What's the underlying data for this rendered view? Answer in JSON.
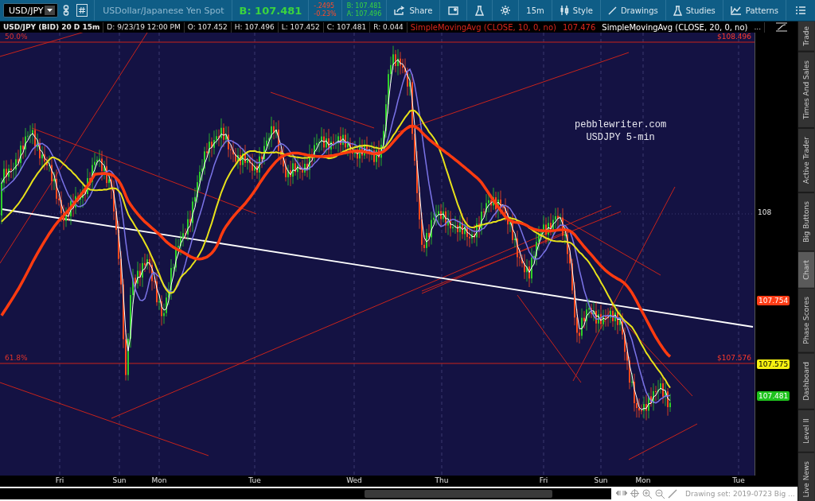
{
  "toolbar": {
    "symbol": "USD/JPY",
    "description": "USDollar/Japanese Yen Spot",
    "last": "B: 107.481",
    "change": "-.2495",
    "change_pct": "-0.23%",
    "bid": "B: 107.481",
    "ask": "A: 107.496",
    "buttons": [
      {
        "kind": "labeled",
        "label": "Share"
      },
      {
        "kind": "icon"
      },
      {
        "kind": "icon"
      },
      {
        "kind": "icon"
      },
      {
        "kind": "labeled",
        "label": "15m"
      },
      {
        "kind": "labeled",
        "label": "Style"
      },
      {
        "kind": "labeled",
        "label": "Drawings"
      },
      {
        "kind": "labeled",
        "label": "Studies"
      },
      {
        "kind": "labeled",
        "label": "Patterns"
      },
      {
        "kind": "icon"
      }
    ]
  },
  "header": {
    "title": "USD/JPY (BID) 20 D 15m",
    "fields": [
      "D: 9/23/19 12:00 PM",
      "O: 107.452",
      "H: 107.496",
      "L: 107.452",
      "C: 107.481",
      "R: 0.044"
    ],
    "studies": [
      {
        "kind": "alert",
        "label": "SimpleMovingAvg (CLOSE, 10, 0, no)",
        "value": "107.476"
      },
      {
        "kind": "plain",
        "label": "SimpleMovingAvg (CLOSE, 20, 0, no)"
      }
    ],
    "more": "..."
  },
  "chart": {
    "levels": [
      {
        "label": "50.0%",
        "price": "$108.496"
      },
      {
        "label": "61.8%",
        "price": "$107.576"
      }
    ],
    "note": [
      "pebblewriter.com",
      "USDJPY 5-min"
    ]
  },
  "price_axis": {
    "tick": "108",
    "markers": [
      {
        "value": "107.754",
        "color": "#ff3d17"
      },
      {
        "value": "107.575",
        "color": "#f4ef12"
      },
      {
        "value": "107.481",
        "color": "#1fc21d"
      }
    ]
  },
  "time_axis": [
    "Fri",
    "Sun",
    "Mon",
    "Tue",
    "Wed",
    "Thu",
    "Fri",
    "Sun",
    "Mon",
    "Tue"
  ],
  "side_tabs": [
    {
      "label": "Trade",
      "selected": false
    },
    {
      "label": "Times And Sales",
      "selected": false
    },
    {
      "label": "Active Trader",
      "selected": false
    },
    {
      "label": "Big Buttons",
      "selected": false
    },
    {
      "label": "Chart",
      "selected": true
    },
    {
      "label": "Phase Scores",
      "selected": false
    },
    {
      "label": "Dashboard",
      "selected": false
    },
    {
      "label": "Level II",
      "selected": false
    },
    {
      "label": "Live News",
      "selected": false
    }
  ],
  "status": {
    "drawing_set": "Drawing set: 2019-0723 Big ..."
  }
}
